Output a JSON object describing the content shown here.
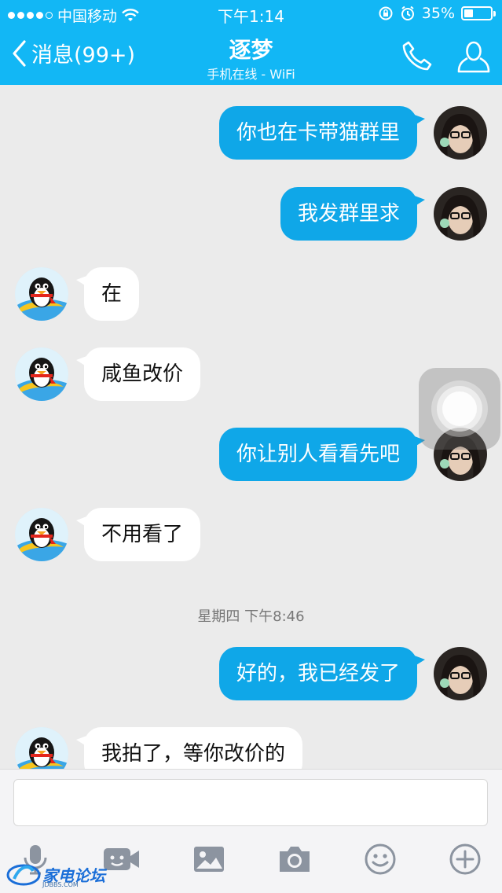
{
  "status_bar": {
    "carrier": "中国移动",
    "time": "下午1:14",
    "battery": "35%",
    "battery_level": 0.35
  },
  "header": {
    "back_label": "消息(99+)",
    "title": "逐梦",
    "subtitle": "手机在线 - WiFi",
    "bg_color": "#12b7f5"
  },
  "messages": [
    {
      "side": "out",
      "text": "你也在卡带猫群里"
    },
    {
      "side": "out",
      "text": "我发群里求"
    },
    {
      "side": "in",
      "text": "在"
    },
    {
      "side": "in",
      "text": "咸鱼改价"
    },
    {
      "side": "out",
      "text": "你让别人看看先吧"
    },
    {
      "side": "in",
      "text": "不用看了"
    },
    {
      "side": "out",
      "text": "好的，我已经发了"
    },
    {
      "side": "in",
      "text": "我拍了，等你改价的"
    }
  ],
  "timestamp": "星期四 下午8:46",
  "input": {
    "value": "",
    "placeholder": ""
  },
  "toolbar": {
    "icons": [
      "microphone-icon",
      "video-call-icon",
      "image-icon",
      "camera-icon",
      "emoji-icon",
      "plus-icon"
    ]
  },
  "watermark": {
    "text": "家电论坛",
    "sub": "JDBBS.COM"
  },
  "colors": {
    "accent": "#12b7f5",
    "out_bubble": "#0fa7e8",
    "in_bubble": "#ffffff",
    "background": "#ebebeb"
  }
}
